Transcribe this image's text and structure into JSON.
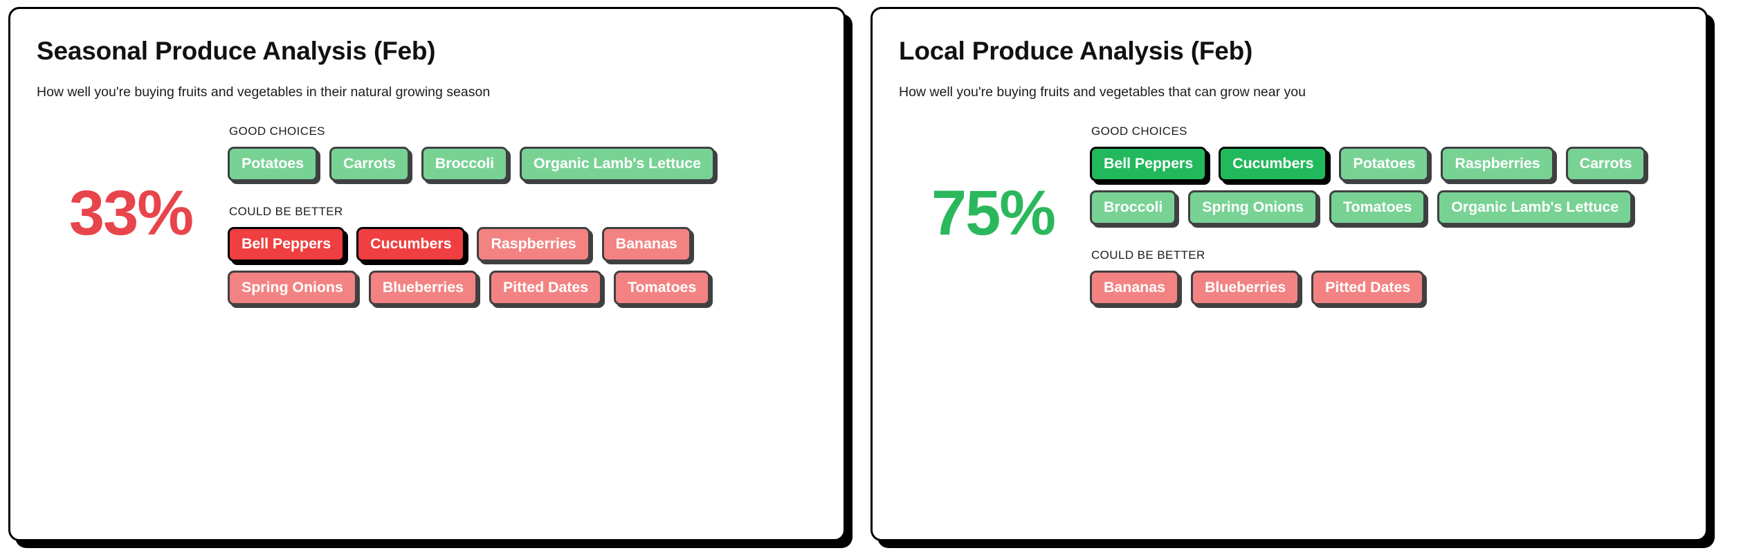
{
  "colors": {
    "good_fill": "#78d294",
    "good_fill_highlight": "#22b85c",
    "bad_fill": "#f28382",
    "bad_fill_highlight": "#ef3f40",
    "tag_border": "#3f4042",
    "tag_border_highlight": "#000000",
    "score_bad": "#e8444b",
    "score_good": "#2bb75c",
    "card_border": "#000000",
    "text_dark": "#111111",
    "tag_text": "#ffffff"
  },
  "cards": [
    {
      "id": "seasonal-produce-analysis",
      "title": "Seasonal Produce Analysis (Feb)",
      "subtitle": "How well you're buying fruits and vegetables in their natural growing season",
      "score": "33%",
      "score_value": 33,
      "score_color": "#e8444b",
      "groups": [
        {
          "label": "GOOD CHOICES",
          "kind": "good",
          "tags": [
            {
              "label": "Potatoes",
              "highlight": false
            },
            {
              "label": "Carrots",
              "highlight": false
            },
            {
              "label": "Broccoli",
              "highlight": false
            },
            {
              "label": "Organic Lamb's Lettuce",
              "highlight": false
            }
          ]
        },
        {
          "label": "COULD BE BETTER",
          "kind": "bad",
          "tags": [
            {
              "label": "Bell Peppers",
              "highlight": true
            },
            {
              "label": "Cucumbers",
              "highlight": true
            },
            {
              "label": "Raspberries",
              "highlight": false
            },
            {
              "label": "Bananas",
              "highlight": false
            },
            {
              "label": "Spring Onions",
              "highlight": false
            },
            {
              "label": "Blueberries",
              "highlight": false
            },
            {
              "label": "Pitted Dates",
              "highlight": false
            },
            {
              "label": "Tomatoes",
              "highlight": false
            }
          ]
        }
      ]
    },
    {
      "id": "local-produce-analysis",
      "title": "Local Produce Analysis (Feb)",
      "subtitle": "How well you're buying fruits and vegetables that can grow near you",
      "score": "75%",
      "score_value": 75,
      "score_color": "#2bb75c",
      "groups": [
        {
          "label": "GOOD CHOICES",
          "kind": "good",
          "tags": [
            {
              "label": "Bell Peppers",
              "highlight": true
            },
            {
              "label": "Cucumbers",
              "highlight": true
            },
            {
              "label": "Potatoes",
              "highlight": false
            },
            {
              "label": "Raspberries",
              "highlight": false
            },
            {
              "label": "Carrots",
              "highlight": false
            },
            {
              "label": "Broccoli",
              "highlight": false
            },
            {
              "label": "Spring Onions",
              "highlight": false
            },
            {
              "label": "Tomatoes",
              "highlight": false
            },
            {
              "label": "Organic Lamb's Lettuce",
              "highlight": false
            }
          ]
        },
        {
          "label": "COULD BE BETTER",
          "kind": "bad",
          "tags": [
            {
              "label": "Bananas",
              "highlight": false
            },
            {
              "label": "Blueberries",
              "highlight": false
            },
            {
              "label": "Pitted Dates",
              "highlight": false
            }
          ]
        }
      ]
    }
  ]
}
